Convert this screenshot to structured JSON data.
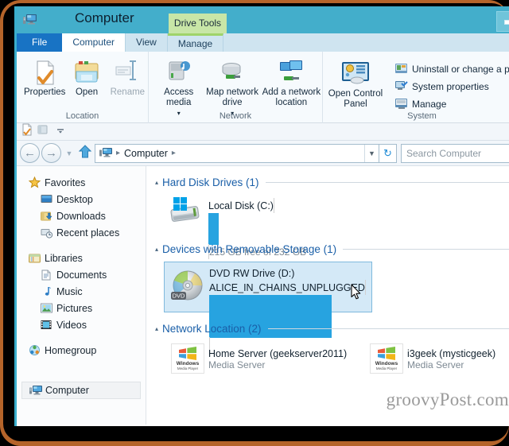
{
  "window": {
    "title": "Computer",
    "contextual_tab": "Drive Tools",
    "minimize_label": "Minimize"
  },
  "tabs": [
    {
      "label": "File",
      "state": "file"
    },
    {
      "label": "Computer",
      "state": "active"
    },
    {
      "label": "View",
      "state": "normal"
    },
    {
      "label": "Manage",
      "state": "contextual"
    }
  ],
  "ribbon": {
    "groups": [
      {
        "title": "Location",
        "buttons": [
          {
            "label": "Properties",
            "icon": "properties-icon",
            "disabled": false
          },
          {
            "label": "Open",
            "icon": "open-folder-icon",
            "disabled": false
          },
          {
            "label": "Rename",
            "icon": "rename-icon",
            "disabled": true
          }
        ]
      },
      {
        "title": "Network",
        "buttons": [
          {
            "label": "Access media",
            "icon": "access-media-icon",
            "dropdown": true
          },
          {
            "label": "Map network drive",
            "icon": "map-network-drive-icon",
            "dropdown": true
          },
          {
            "label": "Add a network location",
            "icon": "add-network-location-icon",
            "dropdown": false
          }
        ]
      },
      {
        "title": "System",
        "big_button": {
          "label": "Open Control Panel",
          "icon": "control-panel-icon"
        },
        "items": [
          {
            "label": "Uninstall or change a pro",
            "icon": "uninstall-program-icon"
          },
          {
            "label": "System properties",
            "icon": "system-properties-icon"
          },
          {
            "label": "Manage",
            "icon": "manage-icon"
          }
        ]
      }
    ]
  },
  "quick_access": {
    "items": [
      {
        "icon": "properties-small-icon",
        "name": "properties"
      },
      {
        "icon": "new-folder-small-icon",
        "name": "new-folder"
      },
      {
        "icon": "chevron-down-icon",
        "name": "customize-qat"
      }
    ]
  },
  "address_bar": {
    "back": "←",
    "forward": "→",
    "history": "▼",
    "up": "↑",
    "crumbs": [
      "Computer"
    ],
    "separator": "▸",
    "dropdown": "▼",
    "refresh": "↻",
    "search_placeholder": "Search Computer",
    "search_value": ""
  },
  "sidebar": {
    "sections": [
      {
        "header": {
          "label": "Favorites",
          "icon": "star-icon"
        },
        "items": [
          {
            "label": "Desktop",
            "icon": "desktop-icon"
          },
          {
            "label": "Downloads",
            "icon": "downloads-icon"
          },
          {
            "label": "Recent places",
            "icon": "recent-places-icon"
          }
        ]
      },
      {
        "header": {
          "label": "Libraries",
          "icon": "libraries-icon"
        },
        "items": [
          {
            "label": "Documents",
            "icon": "documents-icon"
          },
          {
            "label": "Music",
            "icon": "music-icon"
          },
          {
            "label": "Pictures",
            "icon": "pictures-icon"
          },
          {
            "label": "Videos",
            "icon": "videos-icon"
          }
        ]
      },
      {
        "header": {
          "label": "Homegroup",
          "icon": "homegroup-icon"
        },
        "items": []
      }
    ],
    "selected": {
      "label": "Computer",
      "icon": "computer-icon"
    }
  },
  "main": {
    "groups": [
      {
        "title": "Hard Disk Drives (1)",
        "collapse": "▴",
        "items": [
          {
            "name": "Local Disk (C:)",
            "subtitle": "215 GB free of 232 GB",
            "icon": "hard-drive-icon",
            "usage_percent": 7,
            "selected": false
          }
        ]
      },
      {
        "title": "Devices with Removable Storage (1)",
        "collapse": "▴",
        "items": [
          {
            "name": "DVD RW Drive (D:)",
            "subtitle": "ALICE_IN_CHAINS_UNPLUGGED",
            "icon": "dvd-drive-icon",
            "badge": "DVD",
            "usage_percent": 77,
            "selected": true
          }
        ]
      },
      {
        "title": "Network Location (2)",
        "collapse": "▴",
        "items": [
          {
            "name": "Home Server (geekserver2011)",
            "subtitle": "Media Server",
            "icon": "windows-media-player-icon",
            "logo_line1": "Windows",
            "logo_line2": "Media Player",
            "selected": false
          },
          {
            "name": "i3geek (mysticgeek)",
            "subtitle": "Media Server",
            "icon": "windows-media-player-icon",
            "logo_line1": "Windows",
            "logo_line2": "Media Player",
            "selected": false
          }
        ]
      }
    ]
  },
  "watermark": "groovyPost.com",
  "colors": {
    "titlebar": "#43aecb",
    "file_tab": "#1873c4",
    "contextual_tab": "#c8e6a7",
    "group_header": "#1a5fa8",
    "progress_fill": "#27a3e0",
    "selection": "#d4e9f7"
  }
}
